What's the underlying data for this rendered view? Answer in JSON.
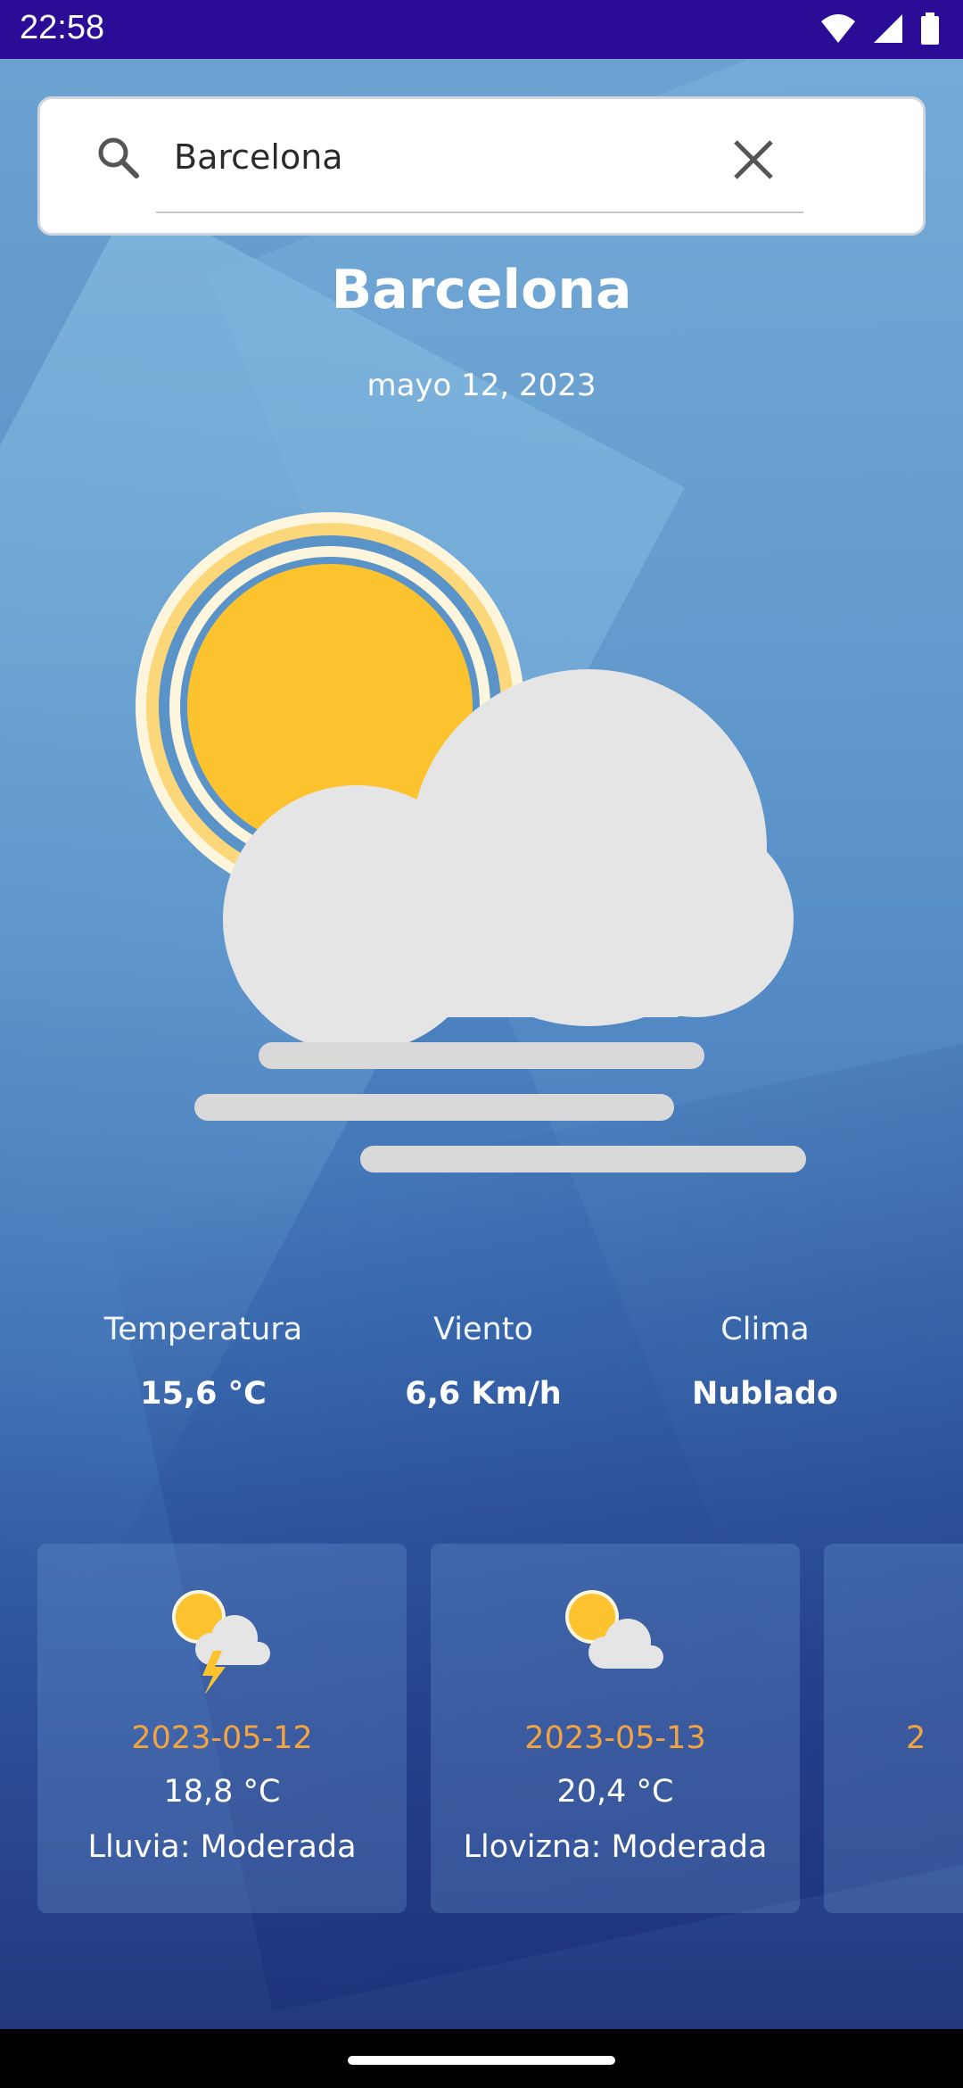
{
  "status_bar": {
    "time": "22:58",
    "icons": [
      "wifi-icon",
      "signal-icon",
      "battery-icon"
    ],
    "background_color": "#2a0c96"
  },
  "search": {
    "value": "Barcelona",
    "icon": "search-icon",
    "clear_icon": "close-icon"
  },
  "location": {
    "city": "Barcelona",
    "date": "mayo 12, 2023",
    "condition_icon": "partly-cloudy-fog-icon"
  },
  "stats": [
    {
      "label": "Temperatura",
      "value": "15,6 °C"
    },
    {
      "label": "Viento",
      "value": "6,6 Km/h"
    },
    {
      "label": "Clima",
      "value": "Nublado"
    }
  ],
  "forecast": [
    {
      "date": "2023-05-12",
      "temp": "18,8 °C",
      "desc": "Lluvia: Moderada",
      "icon": "thunderstorm-partly-cloudy-icon"
    },
    {
      "date": "2023-05-13",
      "temp": "20,4 °C",
      "desc": "Llovizna: Moderada",
      "icon": "partly-cloudy-icon"
    },
    {
      "date": "2",
      "temp": "",
      "desc": "",
      "icon": ""
    }
  ],
  "colors": {
    "accent": "#f3a441",
    "sun": "#fcc32e",
    "cloud": "#e5e5e5"
  }
}
